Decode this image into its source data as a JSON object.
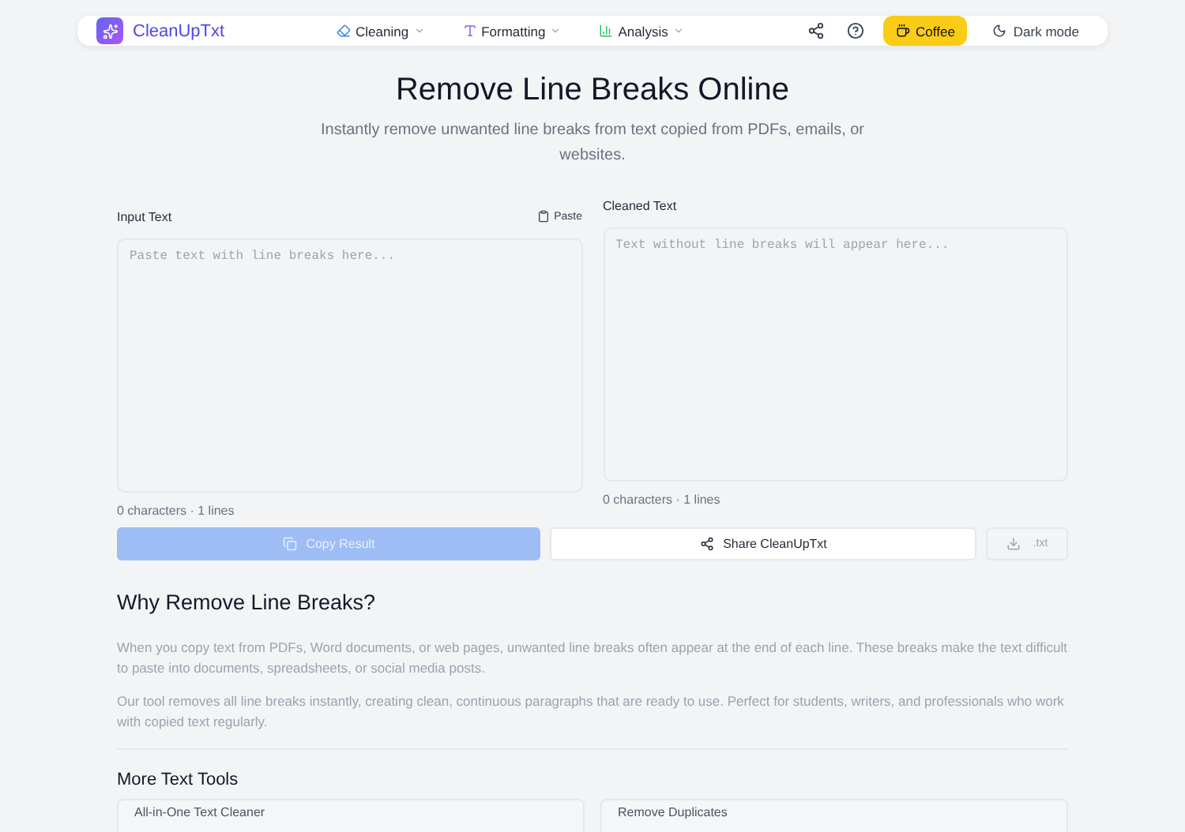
{
  "nav": {
    "brand": "CleanUpTxt",
    "menus": [
      {
        "label": "Cleaning",
        "kind": "cleaning"
      },
      {
        "label": "Formatting",
        "kind": "formatting"
      },
      {
        "label": "Analysis",
        "kind": "analysis"
      }
    ],
    "coffee": "Coffee",
    "dark_mode": "Dark mode"
  },
  "hero": {
    "title": "Remove Line Breaks Online",
    "subtitle": "Instantly remove unwanted line breaks from text copied from PDFs, emails, or websites."
  },
  "input": {
    "label": "Input Text",
    "paste": "Paste",
    "placeholder": "Paste text with line breaks here...",
    "count": "0 characters · 1 lines"
  },
  "output": {
    "label": "Cleaned Text",
    "placeholder": "Text without line breaks will appear here...",
    "count": "0 characters · 1 lines"
  },
  "actions": {
    "copy": {
      "label": "Copy Result",
      "disabled": true
    },
    "share": "Share CleanUpTxt",
    "download": ".txt"
  },
  "why": {
    "heading": "Why Remove Line Breaks?",
    "paragraphs": [
      "When you copy text from PDFs, Word documents, or web pages, unwanted line breaks often appear at the end of each line. These breaks make the text difficult to paste into documents, spreadsheets, or social media posts.",
      "Our tool removes all line breaks instantly, creating clean, continuous paragraphs that are ready to use. Perfect for students, writers, and professionals who work with copied text regularly."
    ]
  },
  "more_tools": {
    "heading": "More Text Tools",
    "cards": [
      "All-in-One Text Cleaner",
      "Remove Duplicates"
    ]
  }
}
